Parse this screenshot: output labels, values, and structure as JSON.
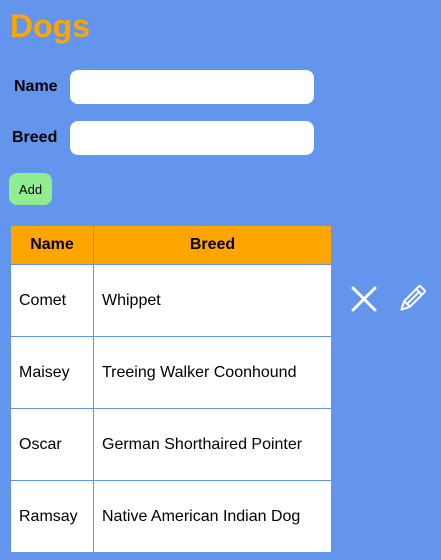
{
  "page": {
    "title": "Dogs"
  },
  "form": {
    "name_label": "Name",
    "name_value": "",
    "breed_label": "Breed",
    "breed_value": "",
    "add_label": "Add"
  },
  "table": {
    "headers": {
      "name": "Name",
      "breed": "Breed"
    },
    "rows": [
      {
        "name": "Comet",
        "breed": "Whippet"
      },
      {
        "name": "Maisey",
        "breed": "Treeing Walker Coonhound"
      },
      {
        "name": "Oscar",
        "breed": "German Shorthaired Pointer"
      },
      {
        "name": "Ramsay",
        "breed": "Native American Indian Dog"
      }
    ]
  },
  "actions": {
    "delete_icon": "close-icon",
    "edit_icon": "pencil-icon"
  },
  "colors": {
    "background": "#6495ED",
    "title": "#FFA500",
    "header": "#FFA500",
    "add_button": "#90EE90"
  }
}
